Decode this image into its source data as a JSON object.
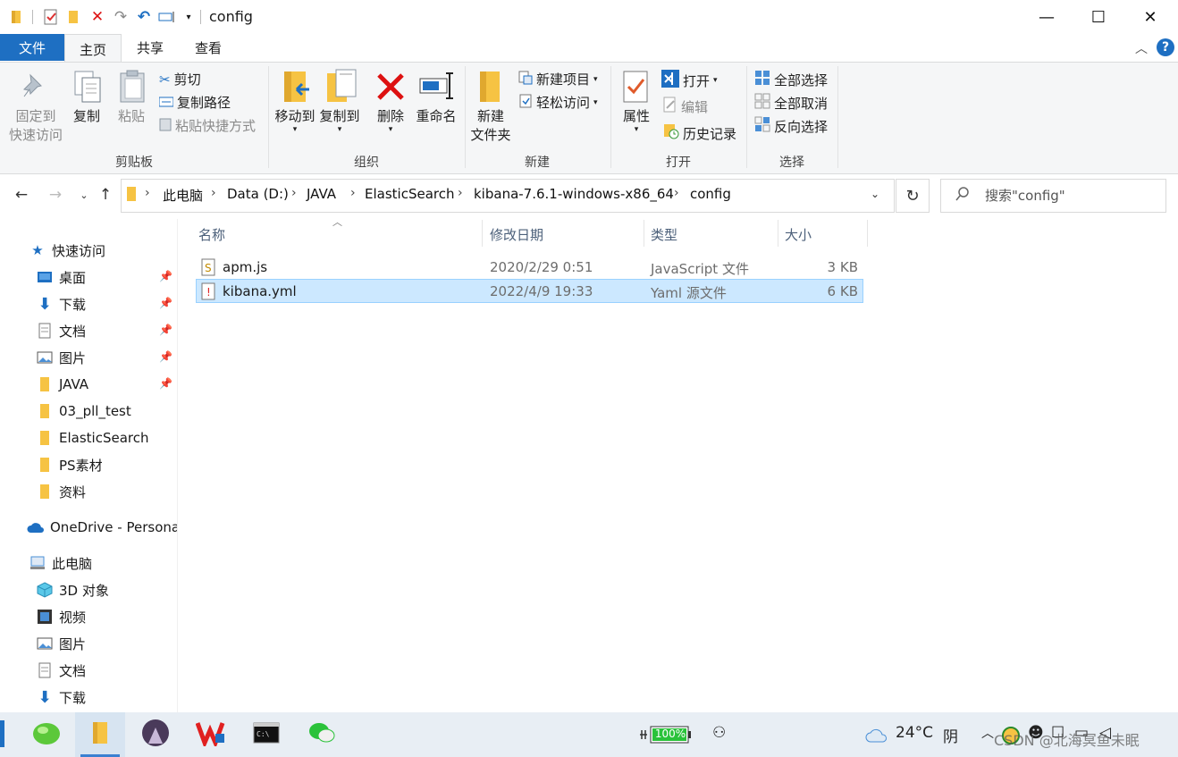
{
  "window": {
    "title": "config",
    "controls": {
      "minimize": "—",
      "maximize": "☐",
      "close": "✕"
    }
  },
  "ribbon": {
    "tabs": [
      "文件",
      "主页",
      "共享",
      "查看"
    ],
    "clipboard": {
      "group": "剪贴板",
      "pin": [
        "固定到",
        "快速访问"
      ],
      "copy": "复制",
      "paste": "粘贴",
      "cut": "剪切",
      "copy_path": "复制路径",
      "paste_shortcut": "粘贴快捷方式"
    },
    "organize": {
      "group": "组织",
      "move_to": "移动到",
      "copy_to": "复制到",
      "delete": "删除",
      "rename": "重命名"
    },
    "new": {
      "group": "新建",
      "new_folder": [
        "新建",
        "文件夹"
      ],
      "new_item": "新建项目",
      "easy_access": "轻松访问"
    },
    "open": {
      "group": "打开",
      "properties": "属性",
      "open": "打开",
      "edit": "编辑",
      "history": "历史记录"
    },
    "select": {
      "group": "选择",
      "select_all": "全部选择",
      "select_none": "全部取消",
      "invert": "反向选择"
    }
  },
  "address": {
    "crumbs": [
      "此电脑",
      "Data (D:)",
      "JAVA",
      "ElasticSearch",
      "kibana-7.6.1-windows-x86_64",
      "config"
    ],
    "search_placeholder": "搜索\"config\""
  },
  "nav": {
    "quick_access": "快速访问",
    "pinned": [
      "桌面",
      "下载",
      "文档",
      "图片",
      "JAVA"
    ],
    "recent": [
      "03_pll_test",
      "ElasticSearch",
      "PS素材",
      "资料"
    ],
    "onedrive": "OneDrive - Persona",
    "this_pc": "此电脑",
    "pc_items": [
      "3D 对象",
      "视频",
      "图片",
      "文档",
      "下载"
    ]
  },
  "files": {
    "columns": [
      "名称",
      "修改日期",
      "类型",
      "大小"
    ],
    "rows": [
      {
        "name": "apm.js",
        "date": "2020/2/29 0:51",
        "type": "JavaScript 文件",
        "size": "3 KB",
        "selected": false
      },
      {
        "name": "kibana.yml",
        "date": "2022/4/9 19:33",
        "type": "Yaml 源文件",
        "size": "6 KB",
        "selected": true
      }
    ]
  },
  "taskbar": {
    "battery": "100%",
    "weather_temp": "24°C",
    "weather_cond": "阴",
    "watermark": "CSDN @北海冥鱼未眠"
  },
  "colors": {
    "file_tab": "#1e6fc2",
    "selection": "#cce8ff",
    "folder": "#f6c343"
  }
}
